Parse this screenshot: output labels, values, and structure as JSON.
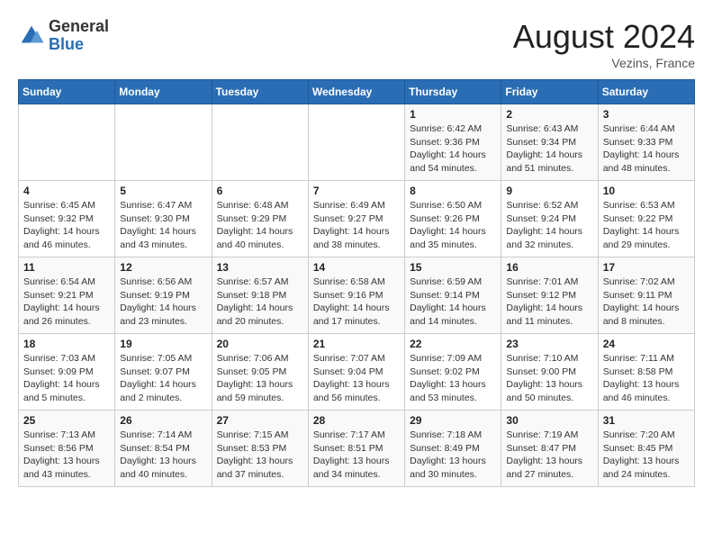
{
  "logo": {
    "general": "General",
    "blue": "Blue"
  },
  "header": {
    "month_year": "August 2024",
    "location": "Vezins, France"
  },
  "days_of_week": [
    "Sunday",
    "Monday",
    "Tuesday",
    "Wednesday",
    "Thursday",
    "Friday",
    "Saturday"
  ],
  "weeks": [
    [
      {
        "day": "",
        "info": ""
      },
      {
        "day": "",
        "info": ""
      },
      {
        "day": "",
        "info": ""
      },
      {
        "day": "",
        "info": ""
      },
      {
        "day": "1",
        "info": "Sunrise: 6:42 AM\nSunset: 9:36 PM\nDaylight: 14 hours\nand 54 minutes."
      },
      {
        "day": "2",
        "info": "Sunrise: 6:43 AM\nSunset: 9:34 PM\nDaylight: 14 hours\nand 51 minutes."
      },
      {
        "day": "3",
        "info": "Sunrise: 6:44 AM\nSunset: 9:33 PM\nDaylight: 14 hours\nand 48 minutes."
      }
    ],
    [
      {
        "day": "4",
        "info": "Sunrise: 6:45 AM\nSunset: 9:32 PM\nDaylight: 14 hours\nand 46 minutes."
      },
      {
        "day": "5",
        "info": "Sunrise: 6:47 AM\nSunset: 9:30 PM\nDaylight: 14 hours\nand 43 minutes."
      },
      {
        "day": "6",
        "info": "Sunrise: 6:48 AM\nSunset: 9:29 PM\nDaylight: 14 hours\nand 40 minutes."
      },
      {
        "day": "7",
        "info": "Sunrise: 6:49 AM\nSunset: 9:27 PM\nDaylight: 14 hours\nand 38 minutes."
      },
      {
        "day": "8",
        "info": "Sunrise: 6:50 AM\nSunset: 9:26 PM\nDaylight: 14 hours\nand 35 minutes."
      },
      {
        "day": "9",
        "info": "Sunrise: 6:52 AM\nSunset: 9:24 PM\nDaylight: 14 hours\nand 32 minutes."
      },
      {
        "day": "10",
        "info": "Sunrise: 6:53 AM\nSunset: 9:22 PM\nDaylight: 14 hours\nand 29 minutes."
      }
    ],
    [
      {
        "day": "11",
        "info": "Sunrise: 6:54 AM\nSunset: 9:21 PM\nDaylight: 14 hours\nand 26 minutes."
      },
      {
        "day": "12",
        "info": "Sunrise: 6:56 AM\nSunset: 9:19 PM\nDaylight: 14 hours\nand 23 minutes."
      },
      {
        "day": "13",
        "info": "Sunrise: 6:57 AM\nSunset: 9:18 PM\nDaylight: 14 hours\nand 20 minutes."
      },
      {
        "day": "14",
        "info": "Sunrise: 6:58 AM\nSunset: 9:16 PM\nDaylight: 14 hours\nand 17 minutes."
      },
      {
        "day": "15",
        "info": "Sunrise: 6:59 AM\nSunset: 9:14 PM\nDaylight: 14 hours\nand 14 minutes."
      },
      {
        "day": "16",
        "info": "Sunrise: 7:01 AM\nSunset: 9:12 PM\nDaylight: 14 hours\nand 11 minutes."
      },
      {
        "day": "17",
        "info": "Sunrise: 7:02 AM\nSunset: 9:11 PM\nDaylight: 14 hours\nand 8 minutes."
      }
    ],
    [
      {
        "day": "18",
        "info": "Sunrise: 7:03 AM\nSunset: 9:09 PM\nDaylight: 14 hours\nand 5 minutes."
      },
      {
        "day": "19",
        "info": "Sunrise: 7:05 AM\nSunset: 9:07 PM\nDaylight: 14 hours\nand 2 minutes."
      },
      {
        "day": "20",
        "info": "Sunrise: 7:06 AM\nSunset: 9:05 PM\nDaylight: 13 hours\nand 59 minutes."
      },
      {
        "day": "21",
        "info": "Sunrise: 7:07 AM\nSunset: 9:04 PM\nDaylight: 13 hours\nand 56 minutes."
      },
      {
        "day": "22",
        "info": "Sunrise: 7:09 AM\nSunset: 9:02 PM\nDaylight: 13 hours\nand 53 minutes."
      },
      {
        "day": "23",
        "info": "Sunrise: 7:10 AM\nSunset: 9:00 PM\nDaylight: 13 hours\nand 50 minutes."
      },
      {
        "day": "24",
        "info": "Sunrise: 7:11 AM\nSunset: 8:58 PM\nDaylight: 13 hours\nand 46 minutes."
      }
    ],
    [
      {
        "day": "25",
        "info": "Sunrise: 7:13 AM\nSunset: 8:56 PM\nDaylight: 13 hours\nand 43 minutes."
      },
      {
        "day": "26",
        "info": "Sunrise: 7:14 AM\nSunset: 8:54 PM\nDaylight: 13 hours\nand 40 minutes."
      },
      {
        "day": "27",
        "info": "Sunrise: 7:15 AM\nSunset: 8:53 PM\nDaylight: 13 hours\nand 37 minutes."
      },
      {
        "day": "28",
        "info": "Sunrise: 7:17 AM\nSunset: 8:51 PM\nDaylight: 13 hours\nand 34 minutes."
      },
      {
        "day": "29",
        "info": "Sunrise: 7:18 AM\nSunset: 8:49 PM\nDaylight: 13 hours\nand 30 minutes."
      },
      {
        "day": "30",
        "info": "Sunrise: 7:19 AM\nSunset: 8:47 PM\nDaylight: 13 hours\nand 27 minutes."
      },
      {
        "day": "31",
        "info": "Sunrise: 7:20 AM\nSunset: 8:45 PM\nDaylight: 13 hours\nand 24 minutes."
      }
    ]
  ]
}
